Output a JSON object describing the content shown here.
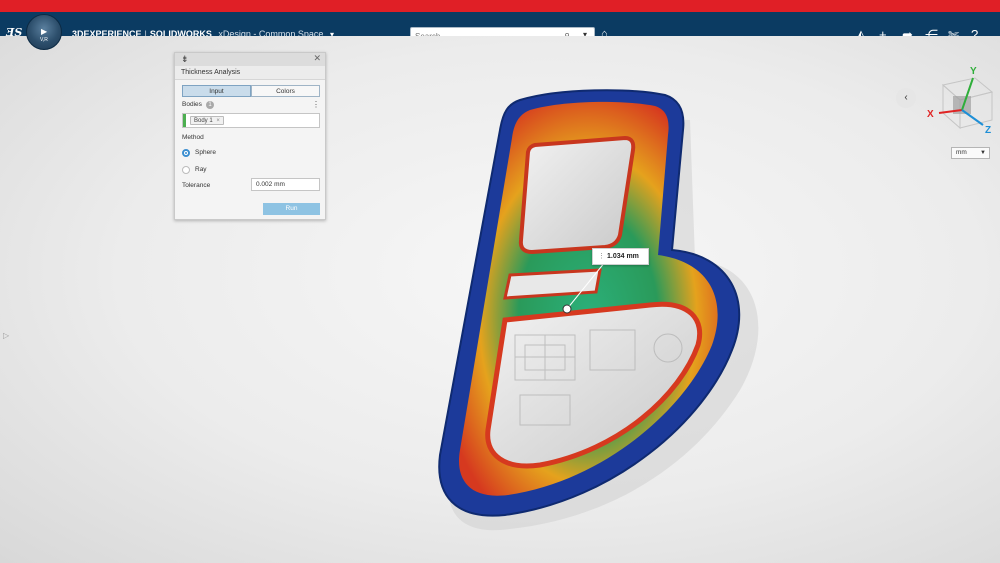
{
  "header": {
    "brand_3dx": "3DEXPERIENCE",
    "brand_sep": "|",
    "brand_sw": "SOLIDWORKS",
    "app_context": "xDesign - Common Space",
    "compass_role": "V,R",
    "search_placeholder": "Search",
    "icons": [
      "3ds-logo-icon",
      "search-icon",
      "tag-icon",
      "share-icon",
      "add-icon",
      "forward-icon",
      "network-icon",
      "tools-icon",
      "help-icon"
    ]
  },
  "panel": {
    "title": "Thickness Analysis",
    "tabs": [
      "Input",
      "Colors"
    ],
    "active_tab": "Input",
    "bodies_label": "Bodies",
    "bodies_count": "1",
    "body_chip": "Body 1",
    "chip_remove": "×",
    "method_label": "Method",
    "methods": [
      "Sphere",
      "Ray"
    ],
    "selected_method": "Sphere",
    "tolerance_label": "Tolerance",
    "tolerance_value": "0.002 mm",
    "run_label": "Run"
  },
  "viewport": {
    "measurement": "1.034 mm",
    "units": "mm",
    "triad": {
      "x": "X",
      "y": "Y",
      "z": "Z"
    }
  },
  "colors": {
    "accent_red": "#e01f26",
    "topbar_blue": "#0b3b62",
    "thickness_thin": "#1f3f9e",
    "thickness_mid": "#29a36b",
    "thickness_thick": "#d93a22"
  }
}
